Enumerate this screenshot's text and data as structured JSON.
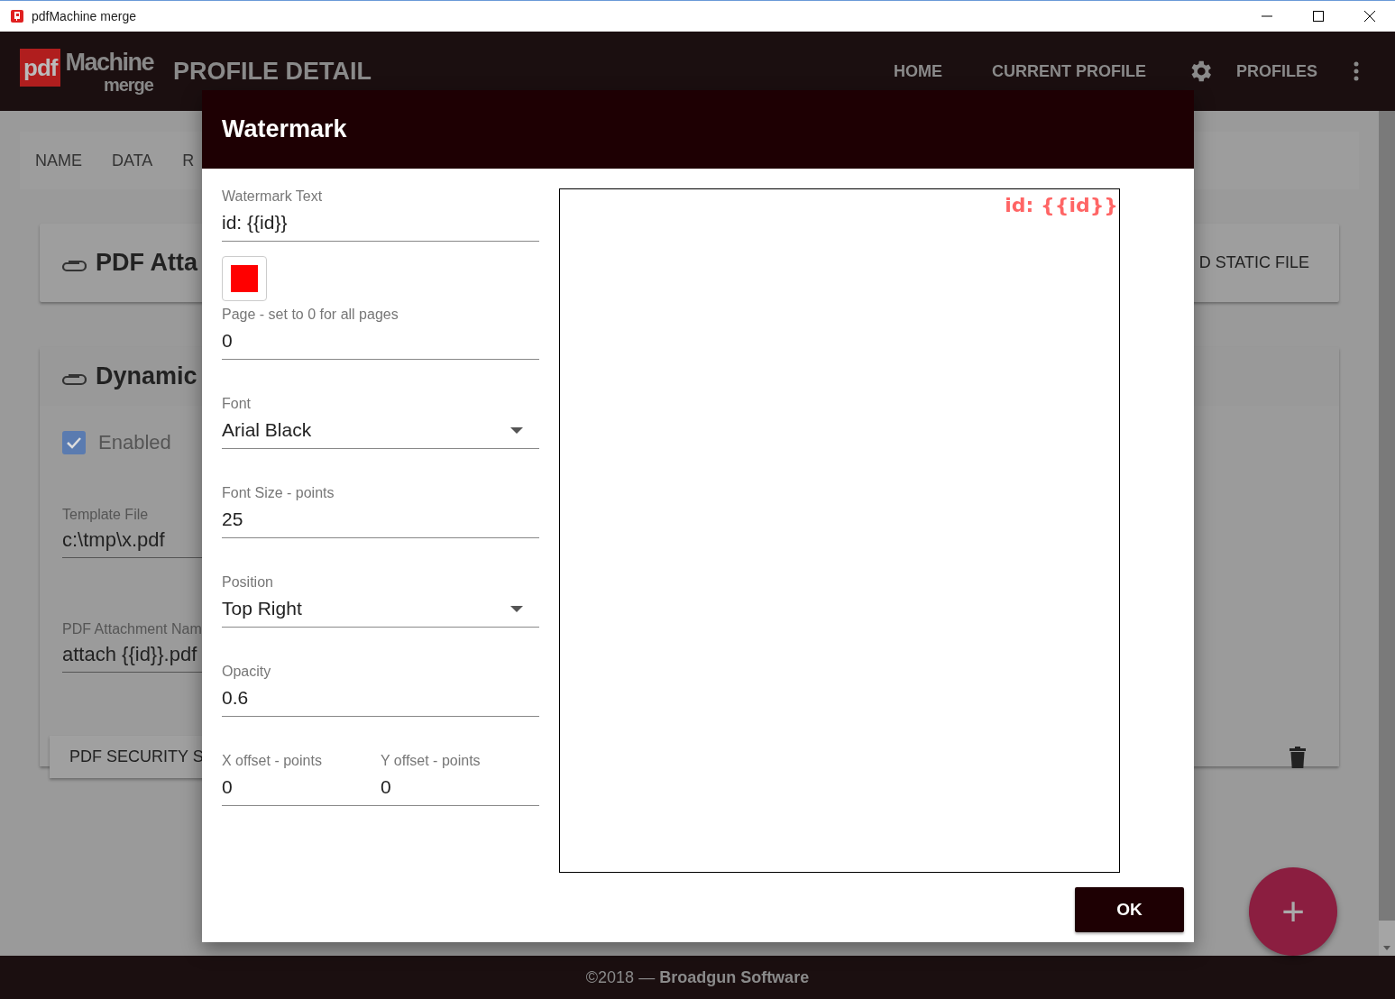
{
  "window": {
    "title": "pdfMachine merge"
  },
  "app_bar": {
    "logo": {
      "left": "pdf",
      "right": "Machine",
      "sub": "merge"
    },
    "title": "PROFILE DETAIL",
    "nav": [
      "HOME",
      "CURRENT PROFILE",
      "PROFILES"
    ]
  },
  "tabs": [
    "NAME",
    "DATA",
    "R"
  ],
  "attachment_card": {
    "title": "PDF Atta",
    "action": "D STATIC FILE"
  },
  "dynamic_card": {
    "title": "Dynamic",
    "enabled": {
      "label": "Enabled",
      "checked": true
    },
    "fields": [
      {
        "label": "Template File",
        "value": "c:\\tmp\\x.pdf"
      },
      {
        "label": "PDF Attachment Nam",
        "value": "attach {{id}}.pdf"
      }
    ],
    "button": "PDF SECURITY S"
  },
  "fab": {
    "label": "+"
  },
  "dialog": {
    "title": "Watermark",
    "fields": [
      {
        "kind": "text",
        "label": "Watermark Text",
        "value": "id: {{id}}"
      },
      {
        "kind": "color",
        "color": "#ff0000"
      },
      {
        "kind": "text",
        "label": "Page - set to 0 for all pages",
        "value": "0"
      },
      {
        "kind": "select",
        "label": "Font",
        "value": "Arial Black"
      },
      {
        "kind": "text",
        "label": "Font Size - points",
        "value": "25"
      },
      {
        "kind": "select",
        "label": "Position",
        "value": "Top Right"
      },
      {
        "kind": "text",
        "label": "Opacity",
        "value": "0.6"
      },
      {
        "kind": "pair",
        "items": [
          {
            "label": "X offset - points",
            "value": "0"
          },
          {
            "label": "Y offset - points",
            "value": "0"
          }
        ]
      }
    ],
    "preview": {
      "text": "id: {{id}}"
    },
    "ok": "OK"
  },
  "footer": {
    "text": "©2018 — **Broadgun Software**"
  }
}
